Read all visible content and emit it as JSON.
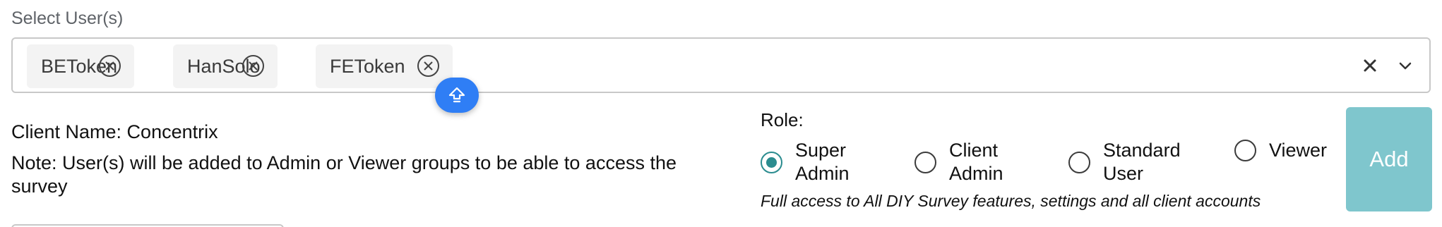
{
  "field": {
    "label": "Select User(s)",
    "selected_users": [
      {
        "name": "BEToken"
      },
      {
        "name": "HanSolo"
      },
      {
        "name": "FEToken"
      }
    ]
  },
  "info": {
    "client_name": "Client Name: Concentrix",
    "note": "Note: User(s) will be added to Admin or Viewer groups to be able to access the survey"
  },
  "role": {
    "label": "Role:",
    "options": [
      {
        "label": "Super Admin",
        "selected": true
      },
      {
        "label": "Client Admin",
        "selected": false
      },
      {
        "label": "Standard User",
        "selected": false
      },
      {
        "label": "Viewer",
        "selected": false
      }
    ],
    "description": "Full access to All DIY Survey features, settings and all client accounts"
  },
  "actions": {
    "add_label": "Add"
  },
  "colors": {
    "accent_teal": "#2b8c8f",
    "add_button_bg": "#7fc6cd",
    "float_button_bg": "#2f7ef5"
  },
  "icons": {
    "chip_remove": "circle-x-icon",
    "clear": "close-icon",
    "dropdown": "chevron-down-icon",
    "float": "arrow-up-icon"
  }
}
